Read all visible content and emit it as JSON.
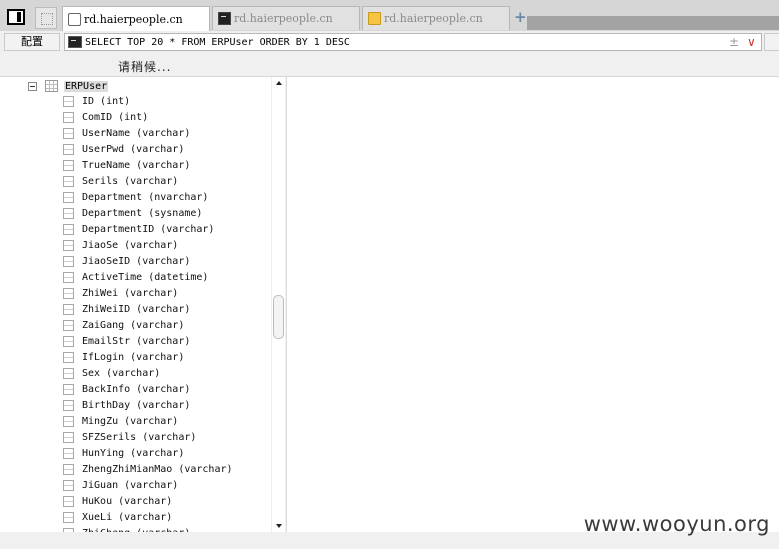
{
  "tabs": [
    {
      "label": "rd.haierpeople.cn",
      "icon": "document-icon",
      "active": true
    },
    {
      "label": "rd.haierpeople.cn",
      "icon": "terminal-icon",
      "active": false
    },
    {
      "label": "rd.haierpeople.cn",
      "icon": "folder-icon",
      "active": false
    }
  ],
  "new_tab_symbol": "+",
  "toolbar": {
    "config_label": "配置",
    "sql_query": "SELECT TOP 20 * FROM ERPUser ORDER BY 1 DESC",
    "plus_minus_symbol": "±",
    "dropdown_symbol": "∨"
  },
  "status_text": "请稍候...",
  "tree": {
    "table_name": "ERPUser",
    "columns": [
      "ID (int)",
      "ComID (int)",
      "UserName (varchar)",
      "UserPwd (varchar)",
      "TrueName (varchar)",
      "Serils (varchar)",
      "Department (nvarchar)",
      "Department (sysname)",
      "DepartmentID (varchar)",
      "JiaoSe (varchar)",
      "JiaoSeID (varchar)",
      "ActiveTime (datetime)",
      "ZhiWei (varchar)",
      "ZhiWeiID (varchar)",
      "ZaiGang (varchar)",
      "EmailStr (varchar)",
      "IfLogin (varchar)",
      "Sex (varchar)",
      "BackInfo (varchar)",
      "BirthDay (varchar)",
      "MingZu (varchar)",
      "SFZSerils (varchar)",
      "HunYing (varchar)",
      "ZhengZhiMianMao (varchar)",
      "JiGuan (varchar)",
      "HuKou (varchar)",
      "XueLi (varchar)",
      "ZhiCheng (varchar)"
    ]
  },
  "watermark": "www.wooyun.org"
}
